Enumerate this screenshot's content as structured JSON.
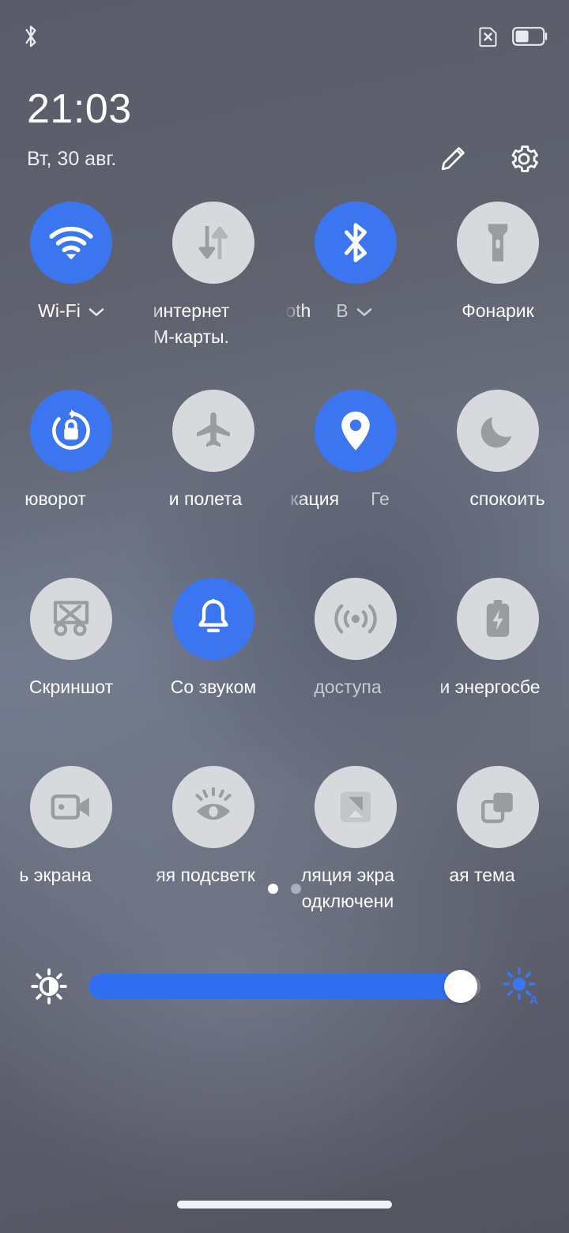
{
  "statusbar": {
    "left_icons": [
      {
        "name": "bluetooth-icon",
        "label": "Bluetooth"
      }
    ],
    "right_icons": [
      {
        "name": "no-sim-card-icon",
        "label": "No SIM card"
      },
      {
        "name": "battery-icon",
        "label": "Battery",
        "level_percent": 48
      }
    ]
  },
  "header": {
    "time": "21:03",
    "date": "Вт, 30 авг.",
    "edit_label": "Изменить",
    "settings_label": "Настройки"
  },
  "tiles": {
    "rows": [
      [
        {
          "id": "wifi",
          "icon": "wifi-icon",
          "state": "on",
          "lines": [
            "Wi-Fi"
          ],
          "has_chevron": true,
          "clip": false,
          "shift": ""
        },
        {
          "id": "mobile-data",
          "icon": "mobile-data-icon",
          "state": "off",
          "lines": [
            "интернет",
            "М-карты."
          ],
          "has_chevron": false,
          "clip": true,
          "shift": "shift-l28"
        },
        {
          "id": "bluetooth",
          "icon": "bluetooth-icon",
          "state": "on",
          "lines": [
            "oth"
          ],
          "secondary": "В",
          "has_chevron": true,
          "clip": true,
          "shift": "shift-l34"
        },
        {
          "id": "flashlight",
          "icon": "flashlight-icon",
          "state": "off",
          "lines": [
            "Фонарик"
          ],
          "has_chevron": false,
          "clip": false,
          "shift": ""
        }
      ],
      [
        {
          "id": "auto-rotate",
          "icon": "rotation-lock-icon",
          "state": "on",
          "lines": [
            "юворот"
          ],
          "has_chevron": false,
          "clip": true,
          "shift": "shift-l20"
        },
        {
          "id": "airplane-mode",
          "icon": "airplane-icon",
          "state": "off",
          "lines": [
            "и полета"
          ],
          "has_chevron": false,
          "clip": true,
          "shift": "shift-l10"
        },
        {
          "id": "location",
          "icon": "location-pin-icon",
          "state": "on",
          "lines": [
            "кация"
          ],
          "secondary": "Ге",
          "has_chevron": false,
          "clip": true,
          "shift": "shift-l20"
        },
        {
          "id": "do-not-disturb",
          "icon": "moon-icon",
          "state": "off",
          "lines": [
            "спокоить"
          ],
          "has_chevron": false,
          "clip": true,
          "shift": "shift-r12"
        }
      ],
      [
        {
          "id": "screenshot",
          "icon": "screenshot-scissors-icon",
          "state": "off",
          "lines": [
            "Скриншот"
          ],
          "has_chevron": false,
          "clip": false,
          "shift": ""
        },
        {
          "id": "sound-mode",
          "icon": "bell-icon",
          "state": "on",
          "lines": [
            "Со звуком"
          ],
          "has_chevron": false,
          "clip": false,
          "shift": ""
        },
        {
          "id": "hotspot",
          "icon": "hotspot-icon",
          "state": "off",
          "lines": [
            "доступа"
          ],
          "has_chevron": false,
          "clip": true,
          "shift": "shift-l10"
        },
        {
          "id": "battery-saver",
          "icon": "battery-bolt-icon",
          "state": "off",
          "lines": [
            "и энергосбе"
          ],
          "has_chevron": false,
          "clip": true,
          "shift": "shift-l10"
        }
      ],
      [
        {
          "id": "screen-recorder",
          "icon": "video-camera-icon",
          "state": "off",
          "lines": [
            "ь экрана"
          ],
          "has_chevron": false,
          "clip": true,
          "shift": "shift-l20"
        },
        {
          "id": "reading-mode",
          "icon": "eye-icon",
          "state": "off",
          "lines": [
            "яя подсветк"
          ],
          "has_chevron": false,
          "clip": true,
          "shift": "shift-l10"
        },
        {
          "id": "cast-screen",
          "icon": "cast-screen-icon",
          "state": "off",
          "lines": [
            "ляция экра",
            "одключени"
          ],
          "has_chevron": false,
          "clip": true,
          "shift": "shift-l10"
        },
        {
          "id": "dark-theme",
          "icon": "dark-theme-icon",
          "state": "off",
          "lines": [
            "ая тема"
          ],
          "has_chevron": false,
          "clip": true,
          "shift": "shift-l20"
        }
      ]
    ]
  },
  "pager": {
    "total_pages": 2,
    "active_page": 1
  },
  "brightness": {
    "value_percent": 95,
    "low_icon": "brightness-low-icon",
    "auto_icon": "brightness-auto-icon",
    "auto_letter": "A"
  },
  "navbar": {
    "gesture_pill": "home-gesture-pill"
  },
  "colors": {
    "accent_on": "#3b76f0",
    "tile_off": "#d7d9dd",
    "icon_off": "#9a9c9f",
    "text_primary": "#ffffff",
    "slider_fill": "#2f6ef0"
  }
}
